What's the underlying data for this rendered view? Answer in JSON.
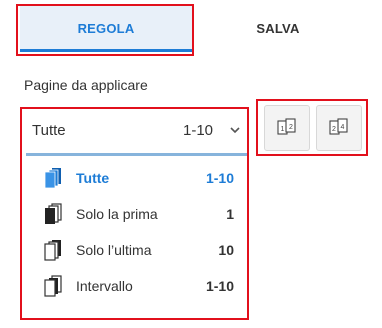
{
  "tabs": [
    {
      "label": "REGOLA",
      "active": true
    },
    {
      "label": "SALVA",
      "active": false
    }
  ],
  "pages_section": {
    "label": "Pagine da applicare",
    "dropdown": {
      "selected_label": "Tutte",
      "selected_range": "1-10",
      "chevron_icon": "chevron-down-icon"
    },
    "options": [
      {
        "label": "Tutte",
        "count": "1-10",
        "icon": "pages-blue-icon",
        "active": true
      },
      {
        "label": "Solo la prima",
        "count": "1",
        "icon": "pages-first-icon",
        "active": false
      },
      {
        "label": "Solo l’ultima",
        "count": "10",
        "icon": "pages-last-icon",
        "active": false
      },
      {
        "label": "Intervallo",
        "count": "1-10",
        "icon": "pages-range-icon",
        "active": false
      }
    ]
  },
  "page_buttons": [
    {
      "icon": "odd-even-pages-icon"
    },
    {
      "icon": "page-order-icon"
    }
  ],
  "colors": {
    "accent": "#1d7cd6",
    "highlight_border": "#e2101c",
    "tab_active_bg": "#e8f0f9"
  }
}
